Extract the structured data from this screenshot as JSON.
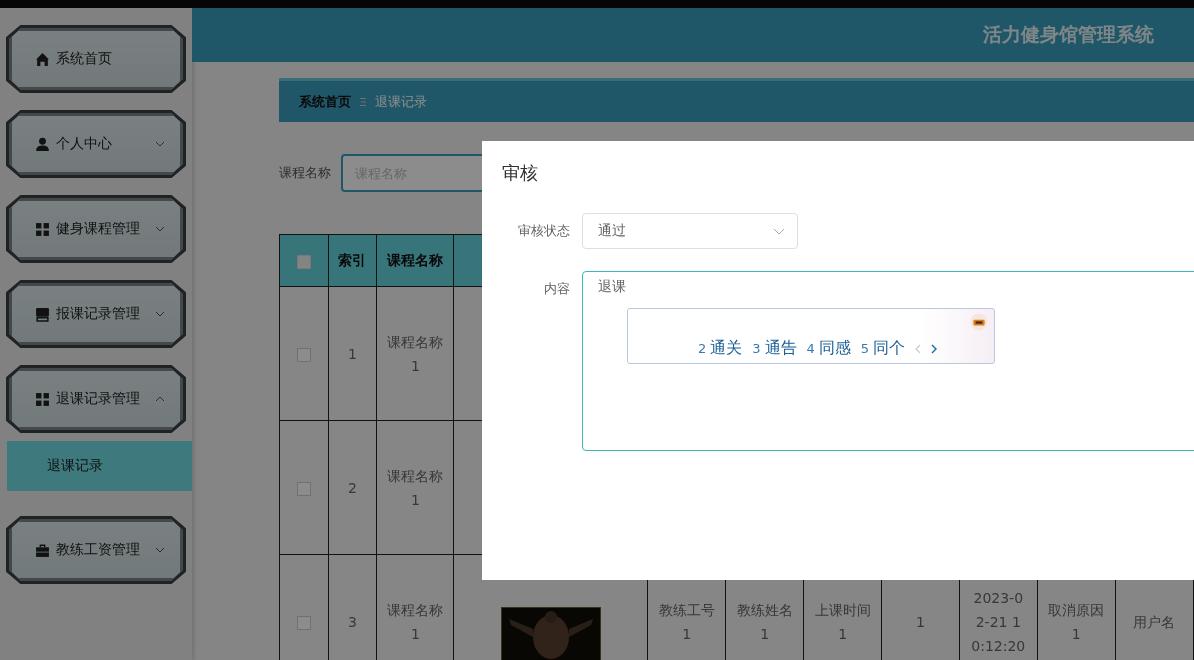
{
  "header": {
    "title": "活力健身馆管理系统"
  },
  "sidebar": {
    "items": [
      {
        "kind": "link",
        "label": "系统首页"
      },
      {
        "kind": "menu",
        "label": "个人中心",
        "expanded": false
      },
      {
        "kind": "menu",
        "label": "健身课程管理",
        "expanded": false
      },
      {
        "kind": "menu",
        "label": "报课记录管理",
        "expanded": false
      },
      {
        "kind": "menu",
        "label": "退课记录管理",
        "expanded": true,
        "children": [
          {
            "label": "退课记录",
            "selected": true
          }
        ]
      },
      {
        "kind": "menu",
        "label": "教练工资管理",
        "expanded": false
      }
    ]
  },
  "breadcrumb": [
    "系统首页",
    "退课记录"
  ],
  "search": {
    "label": "课程名称",
    "placeholder": "课程名称"
  },
  "table": {
    "all_checked": false,
    "columns": [
      "索引",
      "课程名称"
    ],
    "rows": [
      {
        "checked": false,
        "index": "1",
        "course": "课程名称1"
      },
      {
        "checked": false,
        "index": "2",
        "course": "课程名称1"
      },
      {
        "checked": false,
        "index": "3",
        "course": "课程名称1",
        "details": [
          "教练工号1",
          "教练姓名1",
          "上课时间1",
          "1",
          "2023-02-21 10:12:20",
          "取消原因1",
          "用户名"
        ]
      }
    ]
  },
  "dialog": {
    "title": "审核",
    "fields": [
      {
        "kind": "select",
        "label": "审核状态",
        "value": "通过"
      },
      {
        "kind": "textarea",
        "label": "内容",
        "value": "退课"
      }
    ],
    "ime": {
      "candidates": [
        {
          "number": "2",
          "text": "通关"
        },
        {
          "number": "3",
          "text": "通告"
        },
        {
          "number": "4",
          "text": "同感"
        },
        {
          "number": "5",
          "text": "同个"
        }
      ]
    }
  }
}
